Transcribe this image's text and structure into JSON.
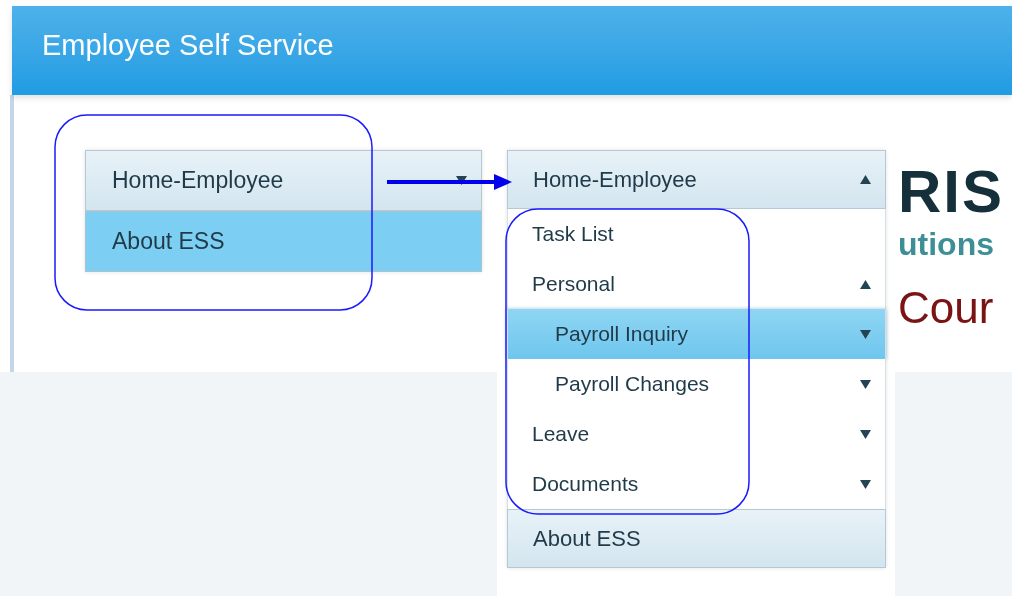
{
  "header": {
    "title": "Employee Self Service"
  },
  "menu_before": {
    "items": [
      {
        "label": "Home-Employee",
        "kind": "header",
        "expanded": false,
        "selected": false
      },
      {
        "label": "About ESS",
        "kind": "header",
        "selected": true
      }
    ]
  },
  "menu_after": {
    "items": [
      {
        "label": "Home-Employee",
        "kind": "header",
        "expanded": true,
        "selected": false,
        "children": [
          {
            "label": "Task List",
            "kind": "item",
            "selected": false
          },
          {
            "label": "Personal",
            "kind": "item",
            "expanded": true,
            "selected": false,
            "children": [
              {
                "label": "Payroll Inquiry",
                "kind": "item",
                "expanded": false,
                "selected": true
              },
              {
                "label": "Payroll Changes",
                "kind": "item",
                "expanded": false,
                "selected": false
              }
            ]
          },
          {
            "label": "Leave",
            "kind": "item",
            "expanded": false,
            "selected": false
          },
          {
            "label": "Documents",
            "kind": "item",
            "expanded": false,
            "selected": false
          }
        ]
      },
      {
        "label": "About ESS",
        "kind": "header",
        "selected": false
      }
    ]
  },
  "logo": {
    "lines": [
      "RIS",
      "utions"
    ]
  },
  "heading": "Cour"
}
